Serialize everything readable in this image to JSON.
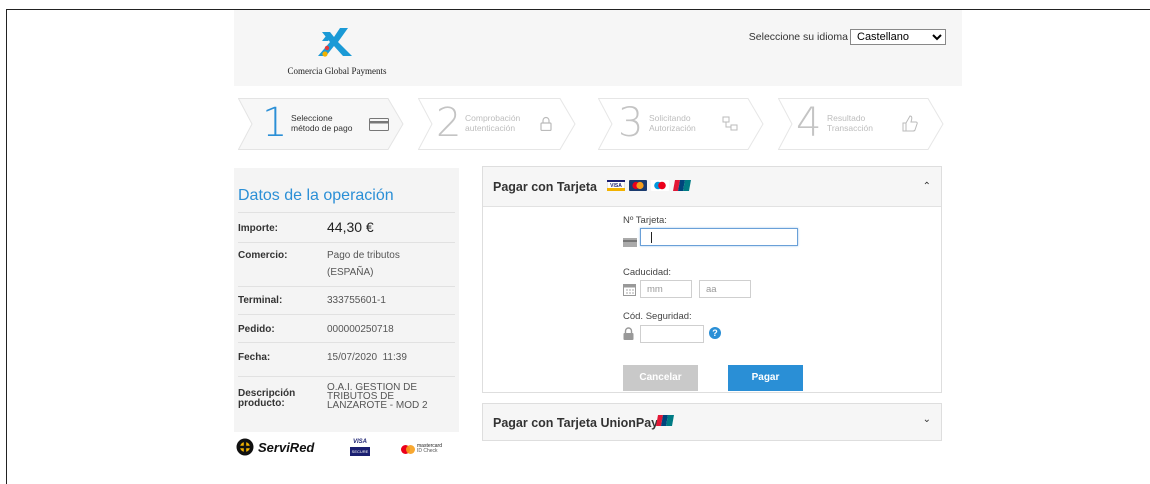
{
  "header": {
    "brand_caption": "Comercia Global Payments",
    "language_label": "Seleccione su idioma",
    "language_selected": "Castellano"
  },
  "steps": [
    {
      "number": "1",
      "line1": "Seleccione",
      "line2": "método de pago",
      "icon": "card-icon",
      "active": true
    },
    {
      "number": "2",
      "line1": "Comprobación",
      "line2": "autenticación",
      "icon": "lock-icon",
      "active": false
    },
    {
      "number": "3",
      "line1": "Solicitando",
      "line2": "Autorización",
      "icon": "network-icon",
      "active": false
    },
    {
      "number": "4",
      "line1": "Resultado",
      "line2": "Transacción",
      "icon": "thumbs-up-icon",
      "active": false
    }
  ],
  "operation": {
    "title": "Datos de la operación",
    "rows": [
      {
        "label": "Importe:",
        "value": "44,30 €"
      },
      {
        "label": "Comercio:",
        "value_lines": [
          "Pago de tributos",
          "(ESPAÑA)"
        ]
      },
      {
        "label": "Terminal:",
        "value": "333755601-1"
      },
      {
        "label": "Pedido:",
        "value": "000000250718"
      },
      {
        "label": "Fecha:",
        "value": "15/07/2020  11:39"
      },
      {
        "label_lines": [
          "Descripción",
          "producto:"
        ],
        "value_lines": [
          "O.A.I. GESTION DE",
          "TRIBUTOS DE",
          "LANZAROTE - MOD 2"
        ]
      }
    ]
  },
  "footer_brands": {
    "servired": "ServiRed",
    "visa": "VISA",
    "visa_sub": "SECURE",
    "mastercard": "mastercard",
    "mastercard_sub": "ID Check"
  },
  "card_payment": {
    "title": "Pagar con Tarjeta",
    "card_number_label": "Nº Tarjeta:",
    "card_number_value": "",
    "expiry_label": "Caducidad:",
    "month_placeholder": "mm",
    "year_placeholder": "aa",
    "cvv_label": "Cód. Seguridad:",
    "cancel_label": "Cancelar",
    "pay_label": "Pagar"
  },
  "unionpay": {
    "title": "Pagar con Tarjeta UnionPay"
  },
  "colors": {
    "accent": "#2a8fd6",
    "logo_blue": "#1b9ad6",
    "cancel_gray": "#c9c9c9"
  }
}
